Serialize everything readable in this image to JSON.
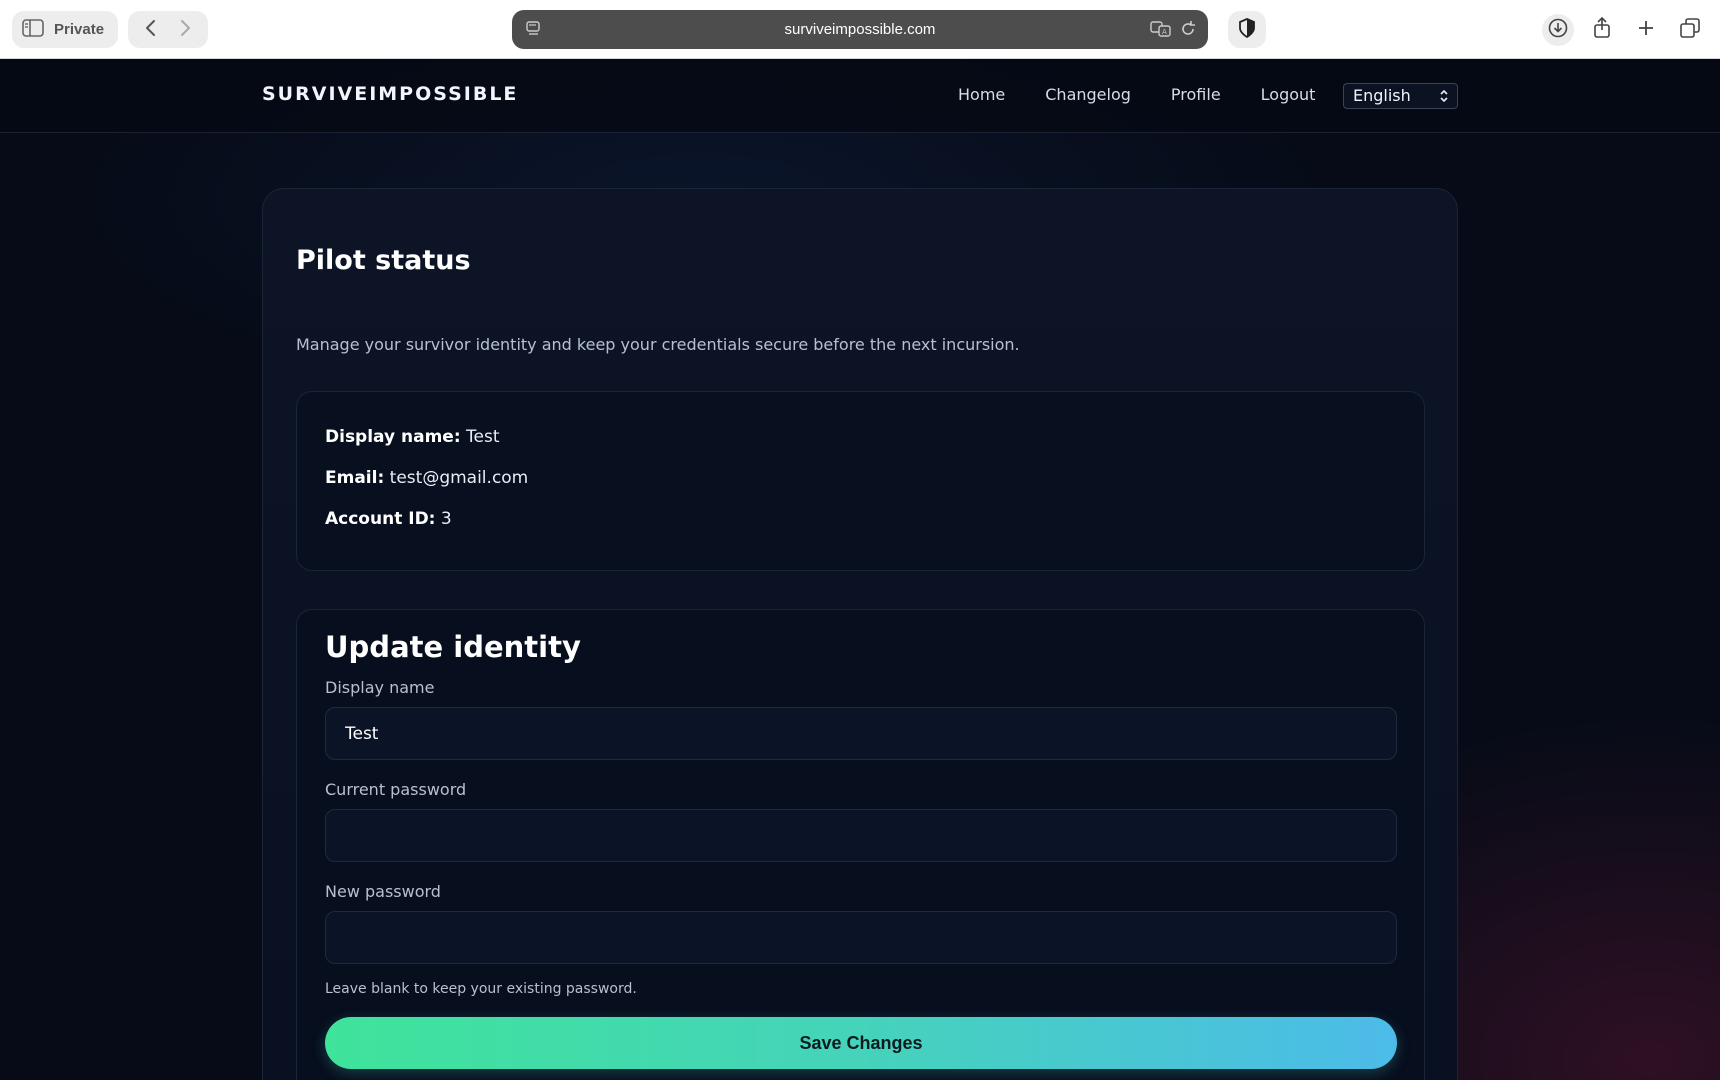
{
  "browser": {
    "private_label": "Private",
    "url": "surviveimpossible.com"
  },
  "site": {
    "brand": "SURVIVEIMPOSSIBLE",
    "nav": [
      "Home",
      "Changelog",
      "Profile",
      "Logout"
    ],
    "language": "English"
  },
  "status": {
    "title": "Pilot status",
    "subtitle": "Manage your survivor identity and keep your credentials secure before the next incursion.",
    "display_name_label": "Display name:",
    "display_name": "Test",
    "email_label": "Email:",
    "email": "test@gmail.com",
    "account_id_label": "Account ID:",
    "account_id": "3"
  },
  "form": {
    "title": "Update identity",
    "display_name_label": "Display name",
    "display_name_value": "Test",
    "current_password_label": "Current password",
    "current_password_value": "",
    "new_password_label": "New password",
    "new_password_value": "",
    "hint": "Leave blank to keep your existing password.",
    "save_label": "Save Changes"
  },
  "colors": {
    "background": "#060b17",
    "accent_start": "#3fe39a",
    "accent_end": "#4cbbe9"
  }
}
